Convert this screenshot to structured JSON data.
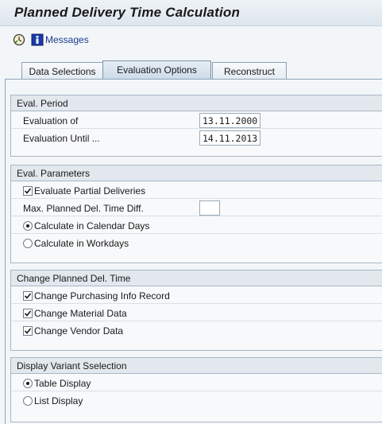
{
  "window": {
    "title": "Planned Delivery Time Calculation"
  },
  "toolbar": {
    "messages_label": "Messages"
  },
  "tabs": [
    {
      "label": "Data Selections"
    },
    {
      "label": "Evaluation Options"
    },
    {
      "label": "Reconstruct"
    }
  ],
  "eval_period": {
    "title": "Eval. Period",
    "evaluation_of_label": "Evaluation of",
    "evaluation_of_value": "13.11.2000",
    "evaluation_until_label": "Evaluation Until ...",
    "evaluation_until_value": "14.11.2013"
  },
  "eval_parameters": {
    "title": "Eval. Parameters",
    "partial_deliveries_label": "Evaluate Partial Deliveries",
    "partial_deliveries_checked": true,
    "max_diff_label": "Max. Planned Del. Time Diff.",
    "max_diff_value": "",
    "calendar_days_label": "Calculate in Calendar Days",
    "calendar_days_selected": true,
    "workdays_label": "Calculate in Workdays",
    "workdays_selected": false
  },
  "change_planned": {
    "title": "Change Planned Del. Time",
    "purchasing_info_label": "Change Purchasing Info Record",
    "purchasing_info_checked": true,
    "material_data_label": "Change Material Data",
    "material_data_checked": true,
    "vendor_data_label": "Change Vendor Data",
    "vendor_data_checked": true
  },
  "display_variant": {
    "title": "Display Variant Sselection",
    "table_display_label": "Table Display",
    "table_display_selected": true,
    "list_display_label": "List Display",
    "list_display_selected": false
  },
  "colors": {
    "background": "#f3f6f9",
    "group_header": "#e2e8ee",
    "active_tab": "#cbdbe9",
    "link": "#1a3a8a"
  }
}
